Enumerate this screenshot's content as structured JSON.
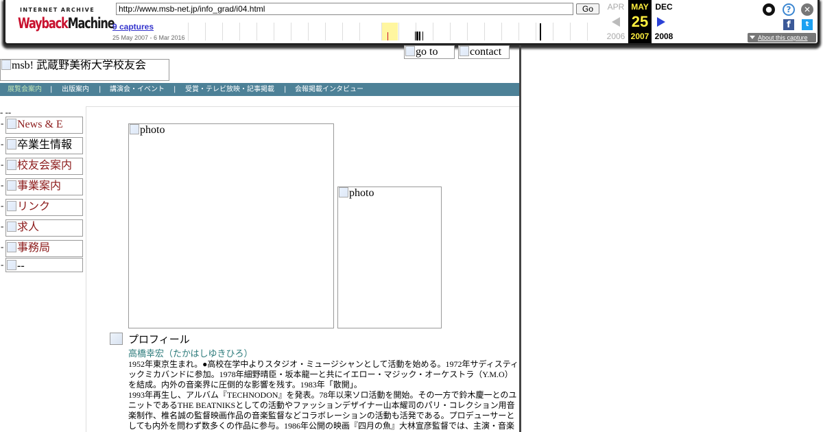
{
  "wayback": {
    "logo_top": "INTERNET ARCHIVE",
    "logo_wayback": "Wayback",
    "logo_machine": "Machine",
    "url": "http://www.msb-net.jp/info_grad/i04.html",
    "go_label": "Go",
    "captures_label": "9 captures",
    "date_range": "25 May 2007 - 6 Mar 2016",
    "prev": {
      "month": "APR",
      "year": "2006"
    },
    "current": {
      "month": "MAY",
      "day": "25",
      "year": "2007"
    },
    "next": {
      "month": "DEC",
      "year": "2008"
    },
    "about_label": "About this capture",
    "colors": {
      "highlight": "#fff6a0",
      "current_bg": "#000000",
      "current_fg": "#ffef3f",
      "link": "#3333cc"
    }
  },
  "header": {
    "logo_alt": "msb! 武蔵野美術大学校友会",
    "goto_alt": "go to",
    "contact_alt": "contact"
  },
  "nav": {
    "items": [
      "展覧会案内",
      "出版案内",
      "講演会・イベント",
      "受賞・テレビ放映・記事掲載",
      "会報掲載インタビュー"
    ],
    "separator": "|"
  },
  "sidebar": {
    "top_dash": "- --",
    "items": [
      {
        "alt": "News & E"
      },
      {
        "alt": "卒業生情報"
      },
      {
        "alt": "校友会案内"
      },
      {
        "alt": "事業案内"
      },
      {
        "alt": "リンク"
      },
      {
        "alt": "求人"
      },
      {
        "alt": "事務局"
      },
      {
        "alt": "--"
      }
    ],
    "bullet": "-"
  },
  "main": {
    "photo1_alt": "photo",
    "photo2_alt": "photo",
    "profile_heading": "プロフィール",
    "profile_name": "高橋幸宏（たかはしゆきひろ）",
    "profile_paragraphs": [
      "1952年東京生まれ。●高校在学中よりスタジオ・ミュージシャンとして活動を始める。1972年サディスティックミカバンドに参加。1978年細野晴臣・坂本龍一と共にイエロー・マジック・オーケストラ（Y.M.O）を結成。内外の音楽界に圧倒的な影響を残す。1983年「散開」。",
      "1993年再生し、アルバム『TECHNODON』を発表。78年以来ソロ活動を開始。その一方で鈴木慶一とのユニットであるTHE BEATNIKSとしての活動やファッションデザイナー山本耀司のパリ・コレクション用音楽制作、椎名誠の監督映画作品の音楽監督などコラボレーションの活動も活発である。プロデューサーとしても内外を問わず数多くの作品に参与。1986年公開の映画『四月の魚』大林宣彦監督では、主演・音楽"
    ]
  }
}
